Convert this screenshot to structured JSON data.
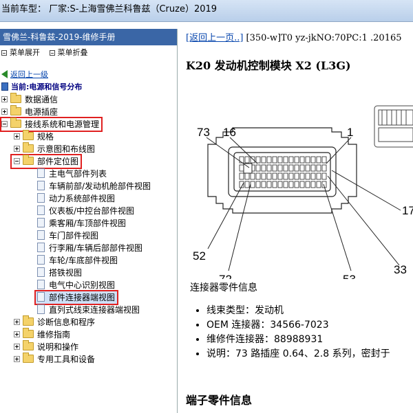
{
  "window": {
    "title": "当前车型： 厂家:S-上海雪佛兰科鲁兹（Cruze）2019"
  },
  "left": {
    "header": "雪佛兰-科鲁兹-2019-维修手册",
    "toolbar": {
      "expand": "菜单展开",
      "collapse": "菜单折叠"
    },
    "back": "返回上一级",
    "current": "当前:电源和信号分布",
    "tree": [
      {
        "label": "数据通信"
      },
      {
        "label": "电源插座"
      },
      {
        "label": "接线系统和电源管理"
      },
      {
        "label": "规格"
      },
      {
        "label": "示意图和布线图"
      },
      {
        "label": "部件定位图"
      },
      {
        "label": "主电气部件列表"
      },
      {
        "label": "车辆前部/发动机舱部件视图"
      },
      {
        "label": "动力系统部件视图"
      },
      {
        "label": "仪表板/中控台部件视图"
      },
      {
        "label": "乘客厢/车顶部件视图"
      },
      {
        "label": "车门部件视图"
      },
      {
        "label": "行李厢/车辆后部部件视图"
      },
      {
        "label": "车轮/车底部件视图"
      },
      {
        "label": "搭铁视图"
      },
      {
        "label": "电气中心识别视图"
      },
      {
        "label": "部件连接器端视图"
      },
      {
        "label": "直列式线束连接器端视图"
      },
      {
        "label": "诊断信息和程序"
      },
      {
        "label": "维修指南"
      },
      {
        "label": "说明和操作"
      },
      {
        "label": "专用工具和设备"
      }
    ]
  },
  "content": {
    "back_link": "[返回上一页..]",
    "crumb_rest": " [350-w]T0 yz-jkNO:70PC:1 .20165",
    "heading": "K20 发动机控制模块 X2 (L3G)",
    "pin_labels": [
      "73",
      "16",
      "1",
      "17",
      "52",
      "72",
      "53",
      "33"
    ],
    "info_title": "连接器零件信息",
    "info": [
      "线束类型：发动机",
      "OEM 连接器：34566-7023",
      "维修件连接器：88988931",
      "说明：73 路插座 0.64、2.8 系列，密封于"
    ],
    "terminal_title": "端子零件信息"
  },
  "colors": {
    "header": "#3a66a6",
    "highlight": "#e02020",
    "link": "#0645ad"
  }
}
